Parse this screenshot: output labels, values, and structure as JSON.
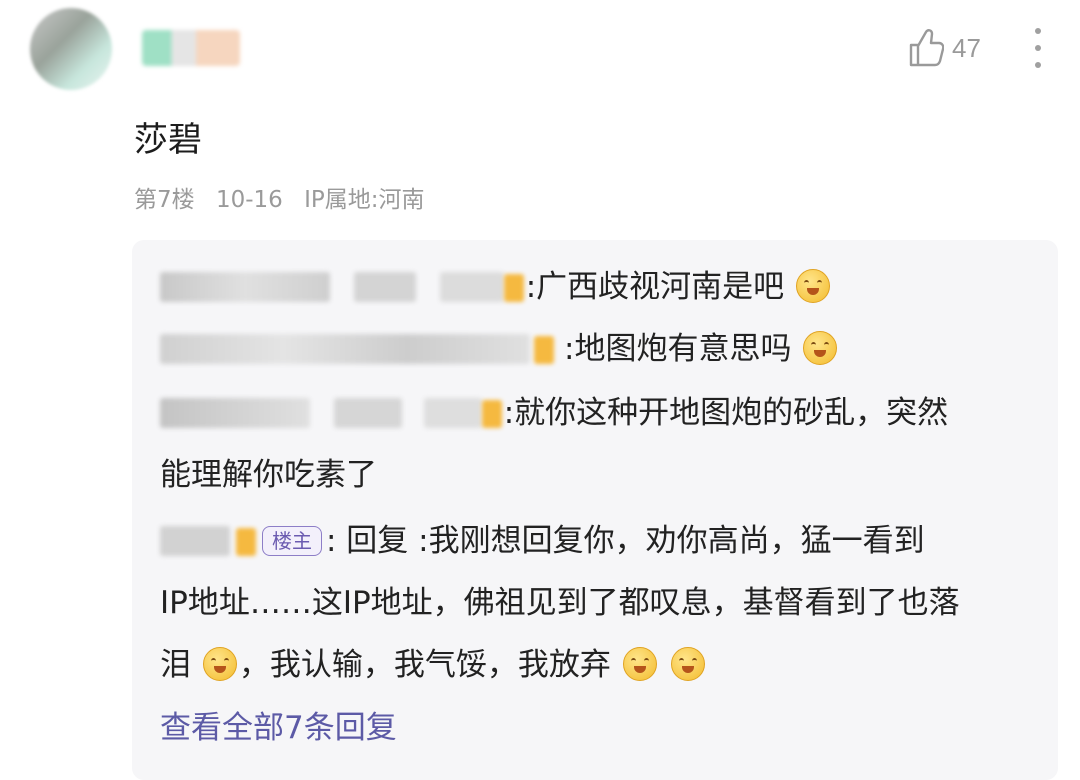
{
  "comment": {
    "like_count": "47",
    "text": "莎碧",
    "meta": {
      "floor": "第7楼",
      "date": "10-16",
      "ip": "IP属地:河南"
    }
  },
  "replies": [
    {
      "text": ":广西歧视河南是吧"
    },
    {
      "text": ":地图炮有意思吗"
    },
    {
      "text_line1": ":就你这种开地图炮的砂乱，突然",
      "text_line2": "能理解你吃素了"
    },
    {
      "badge": "楼主",
      "text_line1": ": 回复  :我刚想回复你，劝你高尚，猛一看到",
      "text_line2": "IP地址……这IP地址，佛祖见到了都叹息，基督看到了也落",
      "text_line3a": "泪",
      "text_line3b": "，我认输，我气馁，我放弃"
    }
  ],
  "view_all": "查看全部7条回复",
  "icons": [
    "thumbs-up-icon",
    "more-vertical-icon",
    "emoji-icon"
  ],
  "colors": {
    "meta_gray": "#9a9a9a",
    "reply_bg": "#f6f6f8",
    "link_purple": "#5c5aa6",
    "badge_purple": "#6b5bb0"
  }
}
